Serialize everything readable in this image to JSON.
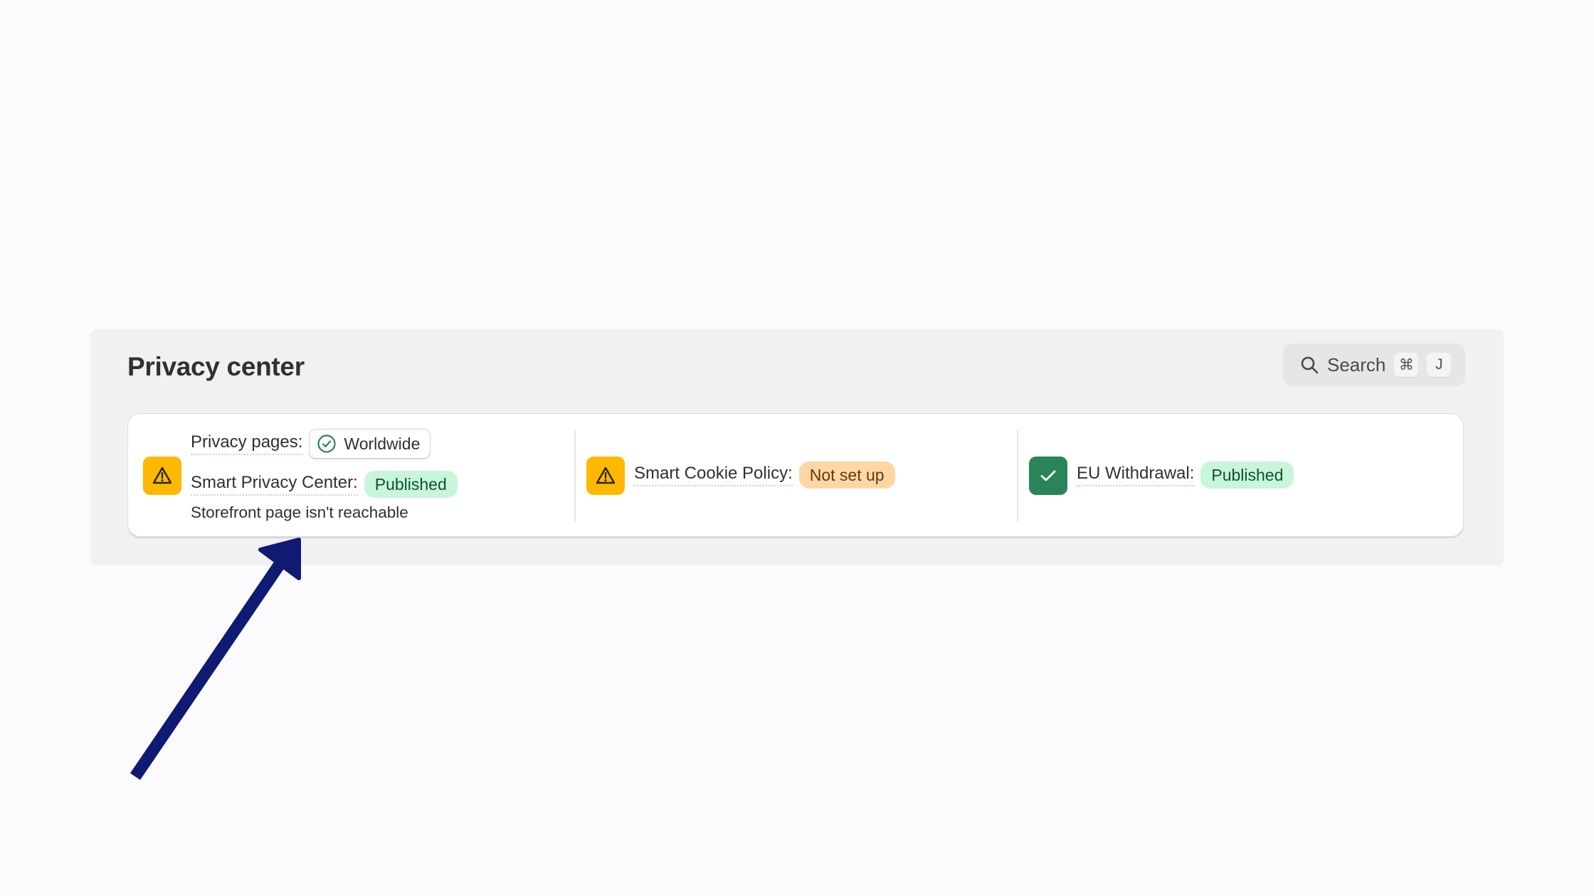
{
  "panel": {
    "title": "Privacy center"
  },
  "search": {
    "label": "Search",
    "shortcut_keys": [
      "⌘",
      "J"
    ]
  },
  "sections": {
    "privacy_pages": {
      "label": "Privacy pages:",
      "region": "Worldwide",
      "status_icon": "warning-icon",
      "smart_privacy_center_label": "Smart Privacy Center:",
      "smart_privacy_center_status": "Published",
      "message": "Storefront page isn't reachable"
    },
    "smart_cookie_policy": {
      "label": "Smart Cookie Policy:",
      "status": "Not set up",
      "status_icon": "warning-icon"
    },
    "eu_withdrawal": {
      "label": "EU Withdrawal:",
      "status": "Published",
      "status_icon": "checkmark-icon"
    }
  },
  "colors": {
    "warning": "#ffb800",
    "success": "#29845a",
    "published_badge_bg": "#c9f5db",
    "not_set_up_badge_bg": "#ffd6a4",
    "annotation_arrow": "#0f1a73"
  }
}
